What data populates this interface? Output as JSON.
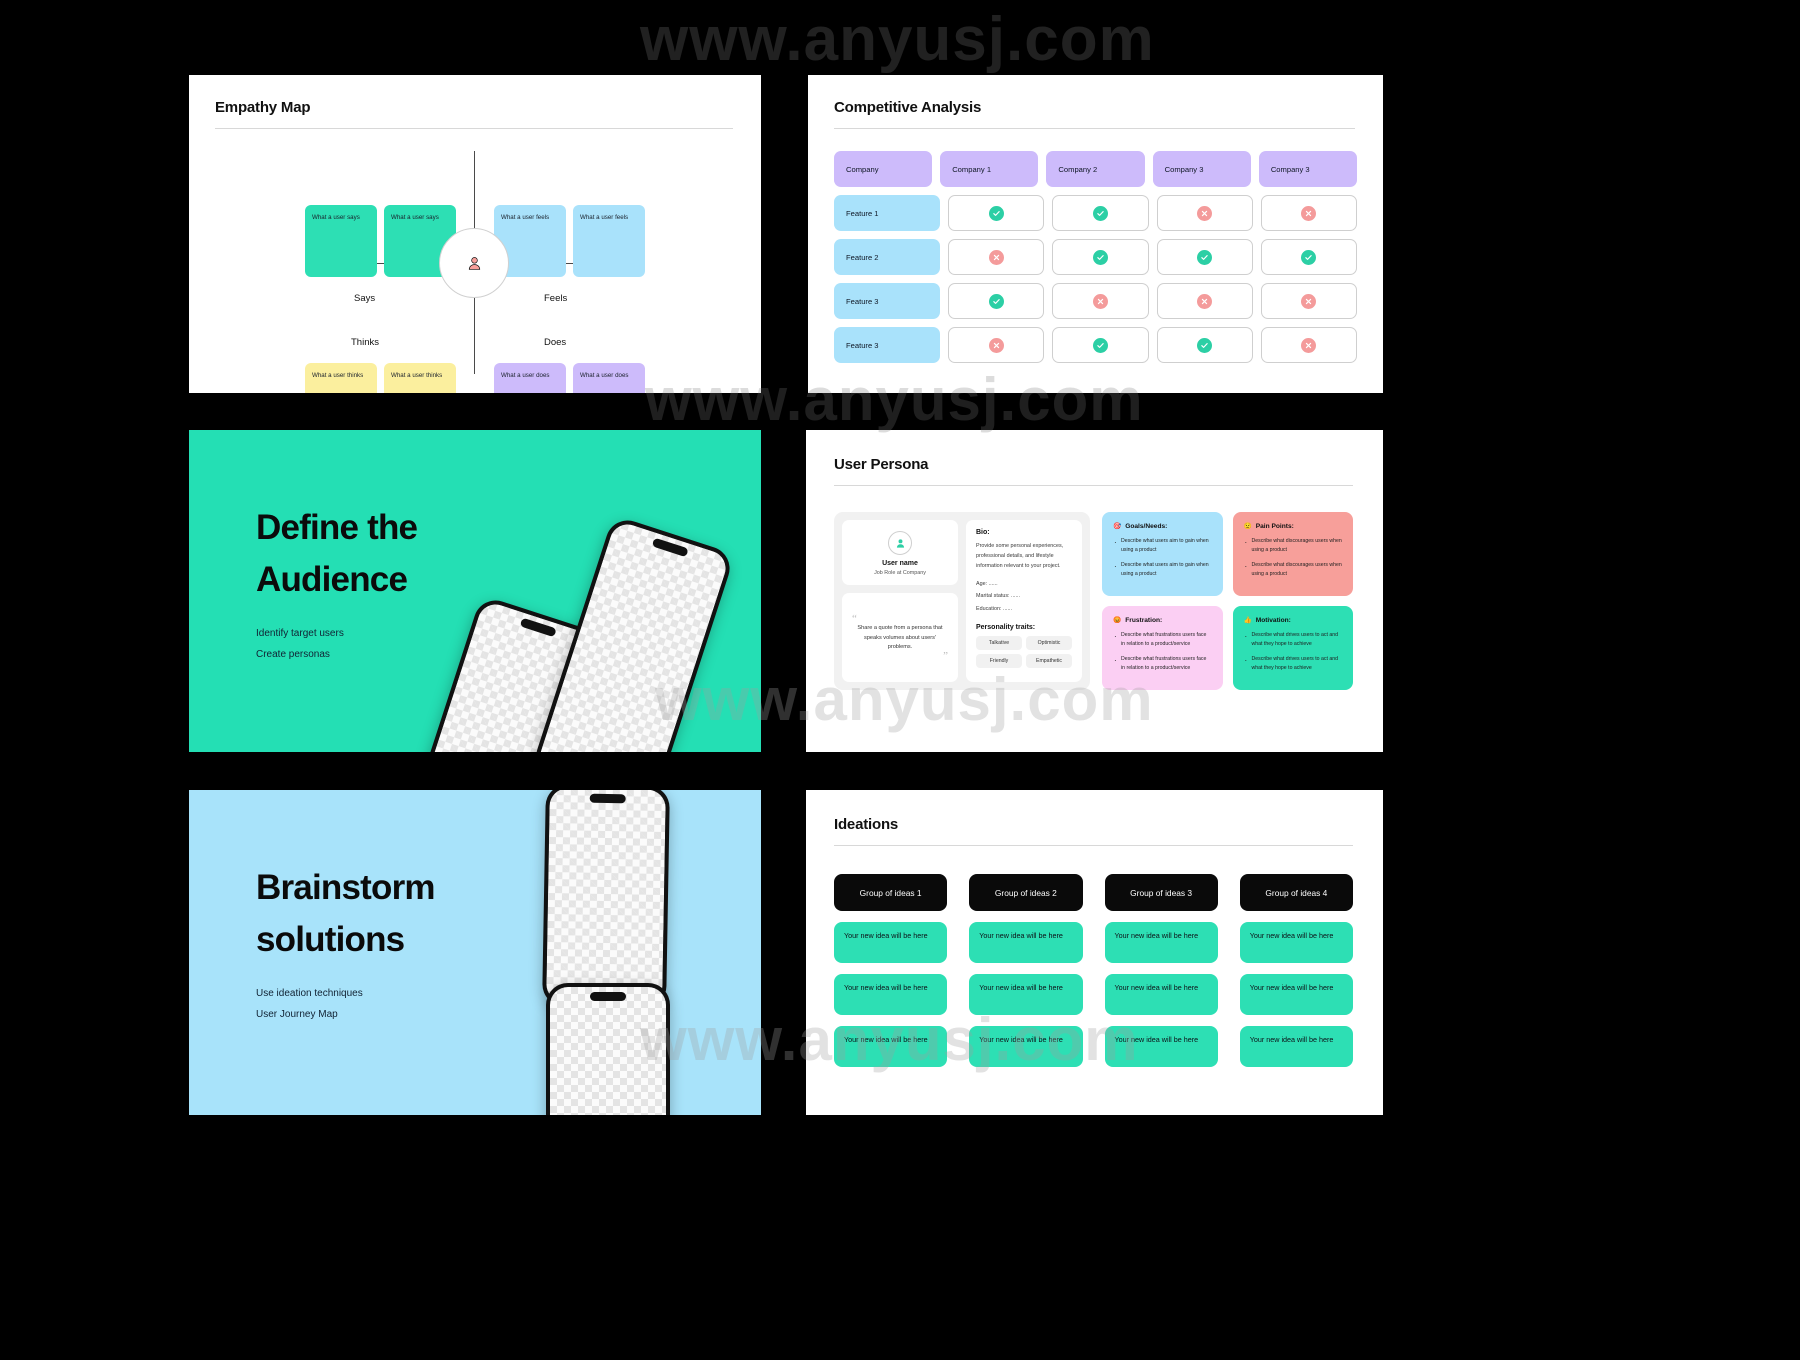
{
  "watermarks": [
    "www.anyusj.com",
    "www.anyusj.com",
    "www.anyusj.com",
    "www.anyusj.com"
  ],
  "colors": {
    "green": "#2ddfb4",
    "blue": "#a9e2fb",
    "yellow": "#fbef9e",
    "purple": "#cdbbfb",
    "red": "#f79f9a",
    "pink": "#fbcff3",
    "black": "#0a0a0a",
    "check": "#2ccfa5",
    "cross": "#f49b9b"
  },
  "slide_empathy": {
    "title": "Empathy Map",
    "quadrants": {
      "says": "Says",
      "feels": "Feels",
      "thinks": "Thinks",
      "does": "Does"
    },
    "notes": {
      "says": [
        "What a user says",
        "What a user says"
      ],
      "feels": [
        "What a user feels",
        "What a user feels"
      ],
      "thinks": [
        "What a user thinks",
        "What a user thinks"
      ],
      "does": [
        "What a user does",
        "What a user does"
      ]
    }
  },
  "slide_competitive": {
    "title": "Competitive Analysis",
    "columns": [
      "Company",
      "Company 1",
      "Company 2",
      "Company 3",
      "Company 3"
    ],
    "rows": [
      {
        "feature": "Feature 1",
        "values": [
          "yes",
          "yes",
          "no",
          "no"
        ]
      },
      {
        "feature": "Feature 2",
        "values": [
          "no",
          "yes",
          "yes",
          "yes"
        ]
      },
      {
        "feature": "Feature 3",
        "values": [
          "yes",
          "no",
          "no",
          "no"
        ]
      },
      {
        "feature": "Feature 3",
        "values": [
          "no",
          "yes",
          "yes",
          "no"
        ]
      }
    ]
  },
  "slide_define": {
    "title_line1": "Define the",
    "title_line2": "Audience",
    "bullets": [
      "Identify target users",
      "Create personas"
    ]
  },
  "slide_persona": {
    "title": "User Persona",
    "card": {
      "user_name": "User name",
      "job_role": "Job Role at Company",
      "quote": "Share a quote from a persona that speaks volumes about users' problems.",
      "bio_heading": "Bio:",
      "bio_text": "Provide some personal experiences, professional details, and lifestyle information relevant to your project.",
      "meta": [
        "Age: ......",
        "Marital status: ......",
        "Education: ......"
      ],
      "traits_heading": "Personality traits:",
      "traits": [
        "Talkative",
        "Optimistic",
        "Friendly",
        "Empathetic"
      ]
    },
    "boxes": [
      {
        "icon": "target-icon",
        "emoji": "🎯",
        "heading": "Goals/Needs:",
        "items": [
          "Describe what users aim to gain when using a product",
          "Describe what users aim to gain when using a product"
        ]
      },
      {
        "icon": "worried-face-icon",
        "emoji": "😟",
        "heading": "Pain Points:",
        "items": [
          "Describe what discourages users when using a product",
          "Describe what discourages users when using a product"
        ]
      },
      {
        "icon": "angry-face-icon",
        "emoji": "😡",
        "heading": "Frustration:",
        "items": [
          "Describe what frustrations users face in relation to a product/service",
          "Describe what frustrations users face in relation to a product/service"
        ]
      },
      {
        "icon": "thumbs-up-icon",
        "emoji": "👍",
        "heading": "Motivation:",
        "items": [
          "Describe what drives users to act and what they hope to achieve",
          "Describe what drives users to act and what they hope to achieve"
        ]
      }
    ]
  },
  "slide_brainstorm": {
    "title_line1": "Brainstorm",
    "title_line2": "solutions",
    "bullets": [
      "Use ideation techniques",
      "User Journey Map"
    ]
  },
  "slide_ideations": {
    "title": "Ideations",
    "groups": [
      {
        "label": "Group of ideas 1",
        "cards": [
          "Your new idea will be here",
          "Your new idea will be here",
          "Your new idea will be here"
        ]
      },
      {
        "label": "Group of ideas 2",
        "cards": [
          "Your new idea will be here",
          "Your new idea will be here",
          "Your new idea will be here"
        ]
      },
      {
        "label": "Group of ideas 3",
        "cards": [
          "Your new idea will be here",
          "Your new idea will be here",
          "Your new idea will be here"
        ]
      },
      {
        "label": "Group of ideas 4",
        "cards": [
          "Your new idea will be here",
          "Your new idea will be here",
          "Your new idea will be here"
        ]
      }
    ]
  }
}
